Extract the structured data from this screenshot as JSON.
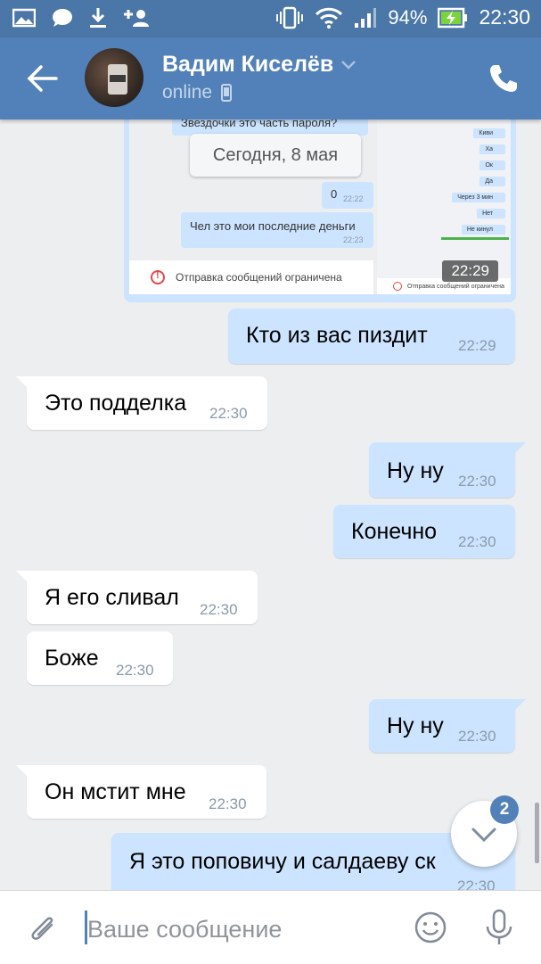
{
  "status_bar": {
    "battery": "94%",
    "time": "22:30"
  },
  "header": {
    "name": "Вадим Киселёв",
    "status": "online"
  },
  "screenshot_attachment": {
    "partial_text": "Звездочки это часть пароля?",
    "date_divider": "Сегодня, 8 мая",
    "messages": [
      {
        "text": "0",
        "time": "22:22"
      },
      {
        "text": "Чел это мои последние деньги",
        "time": "22:23"
      }
    ],
    "restriction": "Отправка сообщений ограничена",
    "right_messages": [
      "Киви",
      "Ха",
      "Ок",
      "Да",
      "Через 3 мин",
      "Нет",
      "Не кинул"
    ],
    "time": "22:29"
  },
  "messages": [
    {
      "text": "Кто из вас пиздит",
      "time": "22:29",
      "dir": "out"
    },
    {
      "text": "Это подделка",
      "time": "22:30",
      "dir": "in"
    },
    {
      "text": "Ну ну",
      "time": "22:30",
      "dir": "out"
    },
    {
      "text": "Конечно",
      "time": "22:30",
      "dir": "out"
    },
    {
      "text": "Я его сливал",
      "time": "22:30",
      "dir": "in"
    },
    {
      "text": "Боже",
      "time": "22:30",
      "dir": "in"
    },
    {
      "text": "Ну ну",
      "time": "22:30",
      "dir": "out"
    },
    {
      "text": "Он мстит мне",
      "time": "22:30",
      "dir": "in"
    },
    {
      "text": "Я это поповичу и салдаеву ск",
      "time": "22:30",
      "dir": "out"
    }
  ],
  "scroll_badge": "2",
  "composer": {
    "placeholder": "Ваше сообщение"
  },
  "colors": {
    "header": "#5181b8",
    "outgoing_bubble": "#cce4ff",
    "incoming_bubble": "#ffffff",
    "background": "#edeef0"
  }
}
